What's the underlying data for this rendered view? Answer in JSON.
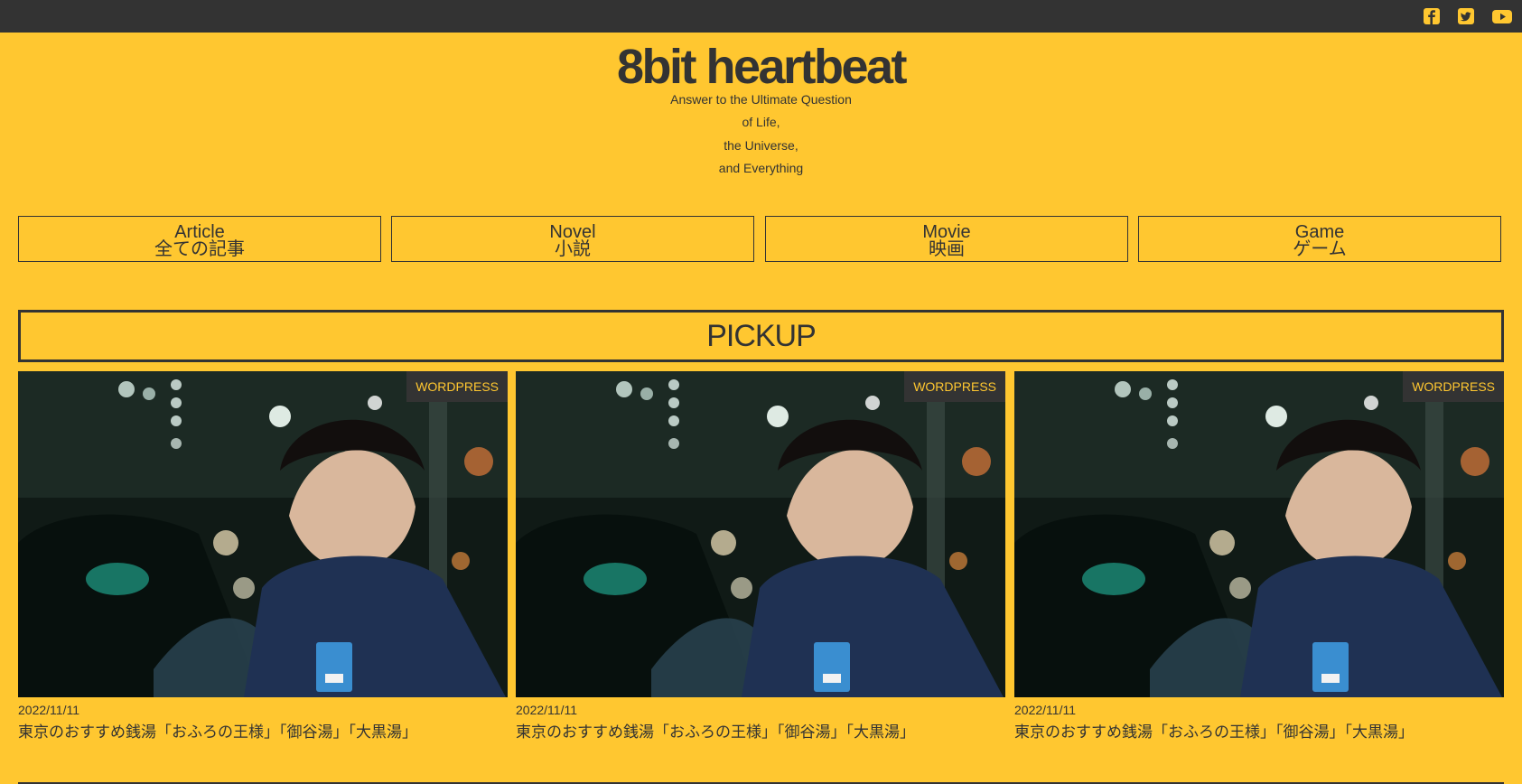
{
  "site": {
    "title": "8bit heartbeat",
    "tagline": [
      "Answer to the Ultimate Question",
      "of Life,",
      "the Universe,",
      "and Everything"
    ]
  },
  "social": [
    {
      "icon": "facebook-square-icon"
    },
    {
      "icon": "twitter-square-icon"
    },
    {
      "icon": "youtube-icon"
    }
  ],
  "nav": [
    {
      "en": "Article",
      "ja": "全ての記事"
    },
    {
      "en": "Novel",
      "ja": "小説"
    },
    {
      "en": "Movie",
      "ja": "映画"
    },
    {
      "en": "Game",
      "ja": "ゲーム"
    }
  ],
  "pickup": {
    "heading": "PICKUP",
    "cards": [
      {
        "category": "WORDPRESS",
        "date": "2022/11/11",
        "title": "東京のおすすめ銭湯「おふろの王様」「御谷湯」「大黒湯」"
      },
      {
        "category": "WORDPRESS",
        "date": "2022/11/11",
        "title": "東京のおすすめ銭湯「おふろの王様」「御谷湯」「大黒湯」"
      },
      {
        "category": "WORDPRESS",
        "date": "2022/11/11",
        "title": "東京のおすすめ銭湯「おふろの王様」「御谷湯」「大黒湯」"
      }
    ]
  },
  "colors": {
    "background": "#ffc730",
    "dark": "#333333",
    "badge_text": "#ffc730"
  }
}
